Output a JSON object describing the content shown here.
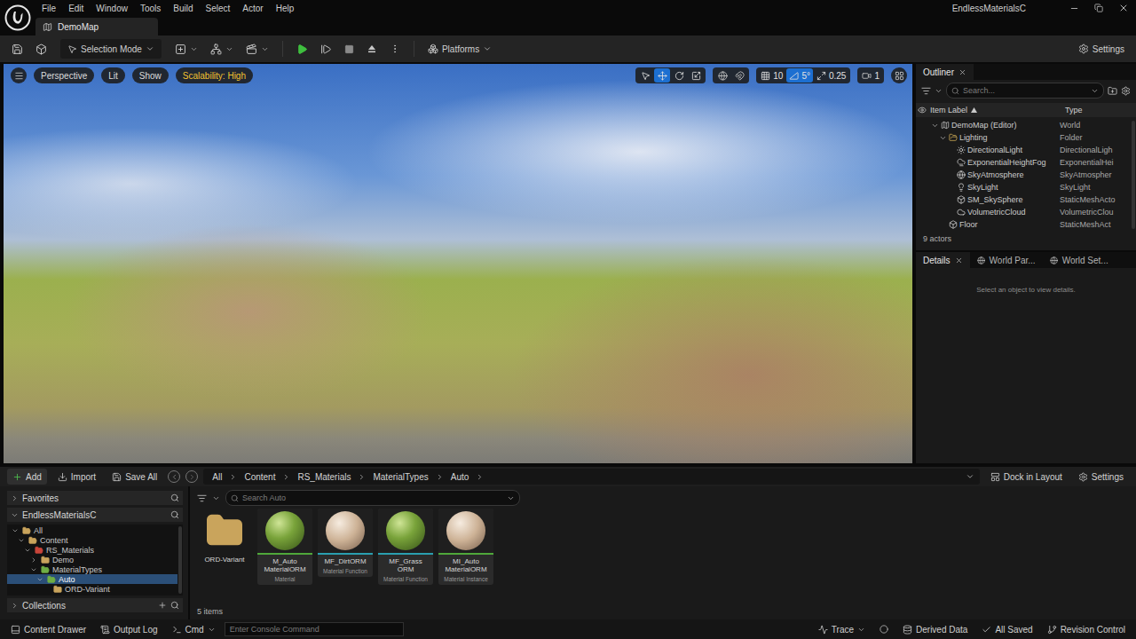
{
  "window": {
    "title": "EndlessMaterialsC"
  },
  "menu": [
    "File",
    "Edit",
    "Window",
    "Tools",
    "Build",
    "Select",
    "Actor",
    "Help"
  ],
  "tabs": [
    {
      "label": "DemoMap",
      "selected": true
    }
  ],
  "toolbar": {
    "mode": "Selection Mode",
    "platforms": "Platforms",
    "settings": "Settings"
  },
  "viewport": {
    "view_buttons": [
      "Perspective",
      "Lit",
      "Show"
    ],
    "scalability": "Scalability: High",
    "tools": [
      {
        "kind": "select",
        "selected": false
      },
      {
        "kind": "move",
        "selected": true
      },
      {
        "kind": "rotate",
        "selected": false
      },
      {
        "kind": "scale",
        "selected": false
      }
    ],
    "snaps": [
      {
        "kind": "grid",
        "value": "10",
        "on": false
      },
      {
        "kind": "rotation",
        "value": "5°",
        "on": true
      },
      {
        "kind": "scale",
        "value": "0.25",
        "on": false
      }
    ],
    "camera_speed": "1"
  },
  "outliner": {
    "title": "Outliner",
    "search": "Search...",
    "columns": [
      "Item Label",
      "Type"
    ],
    "sort_ascending": true,
    "rows": [
      {
        "label": "DemoMap (Editor)",
        "type": "World",
        "depth": 0,
        "expanded": true,
        "kind": "world"
      },
      {
        "label": "Lighting",
        "type": "Folder",
        "depth": 1,
        "expanded": true,
        "kind": "folder"
      },
      {
        "label": "DirectionalLight",
        "type": "DirectionalLigh",
        "depth": 2,
        "expanded": false,
        "kind": "light"
      },
      {
        "label": "ExponentialHeightFog",
        "type": "ExponentialHei",
        "depth": 2,
        "expanded": false,
        "kind": "fog"
      },
      {
        "label": "SkyAtmosphere",
        "type": "SkyAtmospher",
        "depth": 2,
        "expanded": false,
        "kind": "atmosphere"
      },
      {
        "label": "SkyLight",
        "type": "SkyLight",
        "depth": 2,
        "expanded": false,
        "kind": "skylight"
      },
      {
        "label": "SM_SkySphere",
        "type": "StaticMeshActo",
        "depth": 2,
        "expanded": false,
        "kind": "mesh"
      },
      {
        "label": "VolumetricCloud",
        "type": "VolumetricClou",
        "depth": 2,
        "expanded": false,
        "kind": "cloud"
      },
      {
        "label": "Floor",
        "type": "StaticMeshAct",
        "depth": 1,
        "expanded": false,
        "kind": "mesh"
      }
    ],
    "count": "9 actors"
  },
  "details": {
    "tabs": [
      {
        "label": "Details",
        "selected": true,
        "closable": true
      },
      {
        "label": "World Par...",
        "selected": false,
        "closable": false
      },
      {
        "label": "World Set...",
        "selected": false,
        "closable": false
      }
    ],
    "empty": "Select an object to view details."
  },
  "content_browser": {
    "add": "Add",
    "import": "Import",
    "save_all": "Save All",
    "path": [
      "All",
      "Content",
      "RS_Materials",
      "MaterialTypes",
      "Auto"
    ],
    "dock": "Dock in Layout",
    "settings": "Settings",
    "favorites": {
      "label": "Favorites",
      "expanded": false
    },
    "project": {
      "label": "EndlessMaterialsC",
      "expanded": true,
      "tree": [
        {
          "label": "All",
          "depth": 0,
          "has_children": true,
          "expanded": true,
          "selected": false,
          "color": "#c9a45c"
        },
        {
          "label": "Content",
          "depth": 1,
          "has_children": true,
          "expanded": true,
          "selected": false,
          "color": "#c9a45c"
        },
        {
          "label": "RS_Materials",
          "depth": 2,
          "has_children": true,
          "expanded": true,
          "selected": false,
          "color": "#c8453a"
        },
        {
          "label": "Demo",
          "depth": 3,
          "has_children": true,
          "expanded": false,
          "selected": false,
          "color": "#c9a45c"
        },
        {
          "label": "MaterialTypes",
          "depth": 3,
          "has_children": true,
          "expanded": true,
          "selected": false,
          "color": "#6fae45"
        },
        {
          "label": "Auto",
          "depth": 4,
          "has_children": true,
          "expanded": true,
          "selected": true,
          "color": "#6fae45"
        },
        {
          "label": "ORD-Variant",
          "depth": 5,
          "has_children": false,
          "expanded": false,
          "selected": false,
          "color": "#c9a45c"
        }
      ]
    },
    "collections": {
      "label": "Collections",
      "expanded": false
    },
    "search": "Search Auto",
    "assets": [
      {
        "kind": "folder",
        "name": "ORD-Variant",
        "type": "",
        "swatch": "",
        "color": "#c9a45c"
      },
      {
        "kind": "material",
        "name": "M_Auto MaterialORM",
        "type": "Material",
        "swatch": "grass",
        "color": "#4fa83a"
      },
      {
        "kind": "material",
        "name": "MF_DirtORM",
        "type": "Material Function",
        "swatch": "dirt",
        "color": "#2a9fb0"
      },
      {
        "kind": "material",
        "name": "MF_Grass ORM",
        "type": "Material Function",
        "swatch": "grass",
        "color": "#2a9fb0"
      },
      {
        "kind": "material",
        "name": "MI_Auto MaterialORM",
        "type": "Material Instance",
        "swatch": "dirt",
        "color": "#4fa83a"
      }
    ],
    "count": "5 items"
  },
  "status_bar": {
    "content_drawer": "Content Drawer",
    "output_log": "Output Log",
    "cmd": "Cmd",
    "console": "Enter Console Command",
    "trace": "Trace",
    "derived_data": "Derived Data",
    "saved": "All Saved",
    "revision": "Revision Control"
  }
}
